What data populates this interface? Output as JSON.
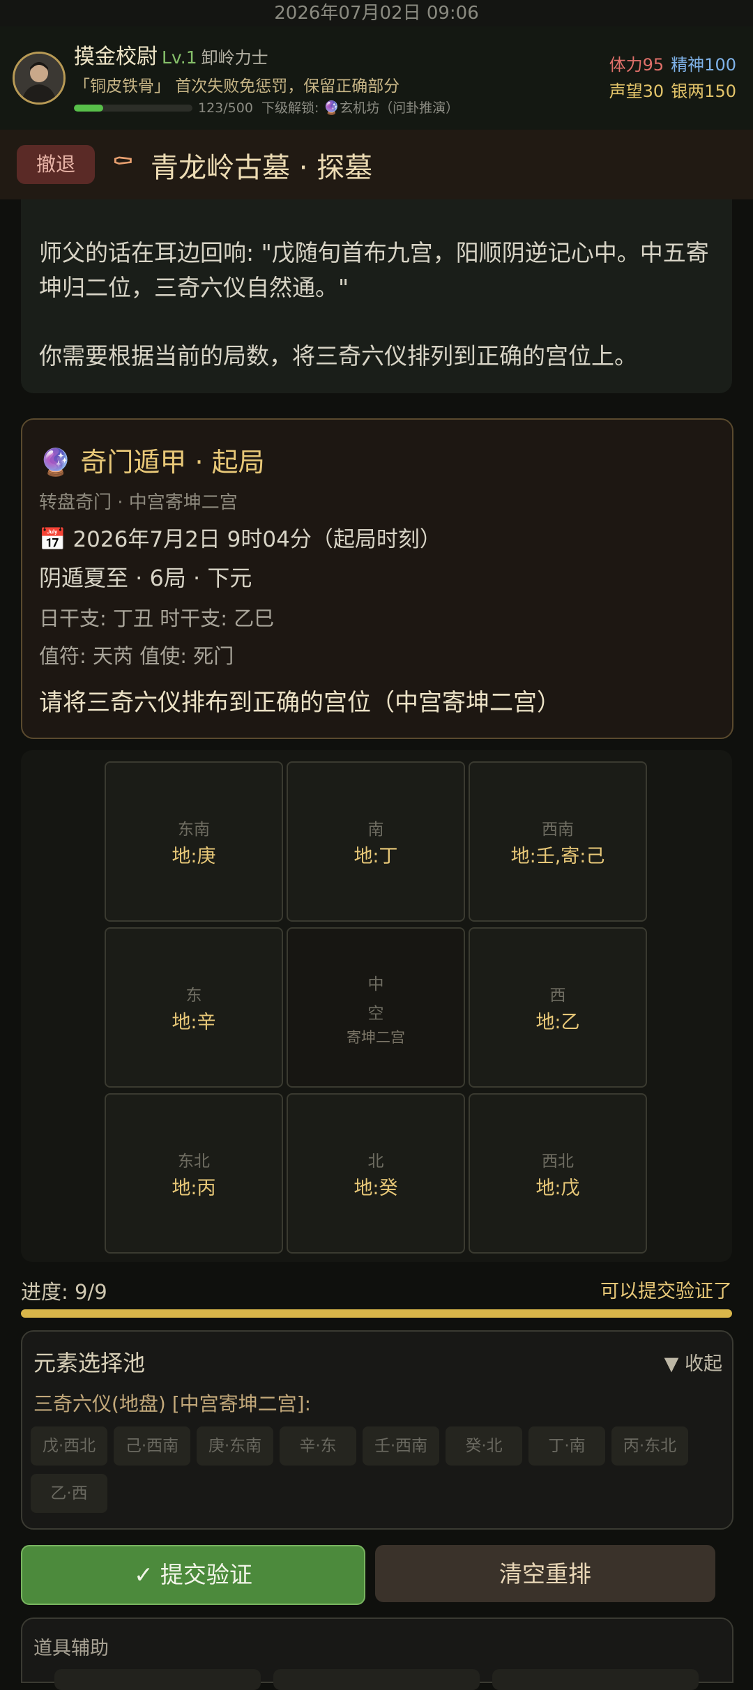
{
  "status_bar": {
    "datetime": "2026年07月02日 09:06"
  },
  "player": {
    "name": "摸金校尉",
    "level": "Lv.1",
    "class": "卸岭力士",
    "buff": "「铜皮铁骨」 首次失败免惩罚，保留正确部分",
    "xp_text": "123/500",
    "xp_fraction": 0.246,
    "unlock_text": "下级解锁: 🔮玄机坊（问卦推演）",
    "stats": {
      "stamina": "体力95",
      "spirit": "精神100",
      "fame": "声望30",
      "silver": "银两150"
    }
  },
  "header": {
    "retreat_label": "撤退",
    "title_icon": "coffin-icon",
    "title": "青龙岭古墓 · 探墓"
  },
  "narration": {
    "line1": "师父的话在耳边回响: \"戊随旬首布九宫，阳顺阴逆记心中。中五寄坤归二位，三奇六仪自然通。\"",
    "line2": "你需要根据当前的局数，将三奇六仪排列到正确的宫位上。"
  },
  "question": {
    "title": "🔮 奇门遁甲 · 起局",
    "subtitle": "转盘奇门 · 中宫寄坤二宫",
    "time": "📅 2026年7月2日 9时04分（起局时刻）",
    "ju": "阴遁夏至 · 6局 · 下元",
    "ganzhi": "日干支: 丁丑  时干支: 乙巳",
    "zhifu": "值符: 天芮  值使: 死门",
    "ask": "请将三奇六仪排布到正确的宫位（中宫寄坤二宫）"
  },
  "board": {
    "palaces": [
      {
        "dir": "东南",
        "val": "地:庚"
      },
      {
        "dir": "南",
        "val": "地:丁"
      },
      {
        "dir": "西南",
        "val": "地:壬,寄:己"
      },
      {
        "dir": "东",
        "val": "地:辛"
      },
      {
        "dir": "中",
        "line2": "空",
        "line3": "寄坤二宫"
      },
      {
        "dir": "西",
        "val": "地:乙"
      },
      {
        "dir": "东北",
        "val": "地:丙"
      },
      {
        "dir": "北",
        "val": "地:癸"
      },
      {
        "dir": "西北",
        "val": "地:戊"
      }
    ]
  },
  "progress": {
    "label": "进度: 9/9",
    "fraction": 1.0,
    "hint": "可以提交验证了"
  },
  "pool": {
    "title": "元素选择池",
    "collapse_label": "▼ 收起",
    "subtitle": "三奇六仪(地盘) [中宫寄坤二宫]:",
    "chips": [
      "戊·西北",
      "己·西南",
      "庚·东南",
      "辛·东",
      "壬·西南",
      "癸·北",
      "丁·南",
      "丙·东北",
      "乙·西"
    ]
  },
  "actions": {
    "submit_label": "提交验证",
    "clear_label": "清空重排"
  },
  "items": {
    "title": "道具辅助"
  },
  "colors": {
    "accent_gold": "#e8c878",
    "submit_green": "#4c8a3c",
    "progress_yellow": "#d9b64a"
  }
}
